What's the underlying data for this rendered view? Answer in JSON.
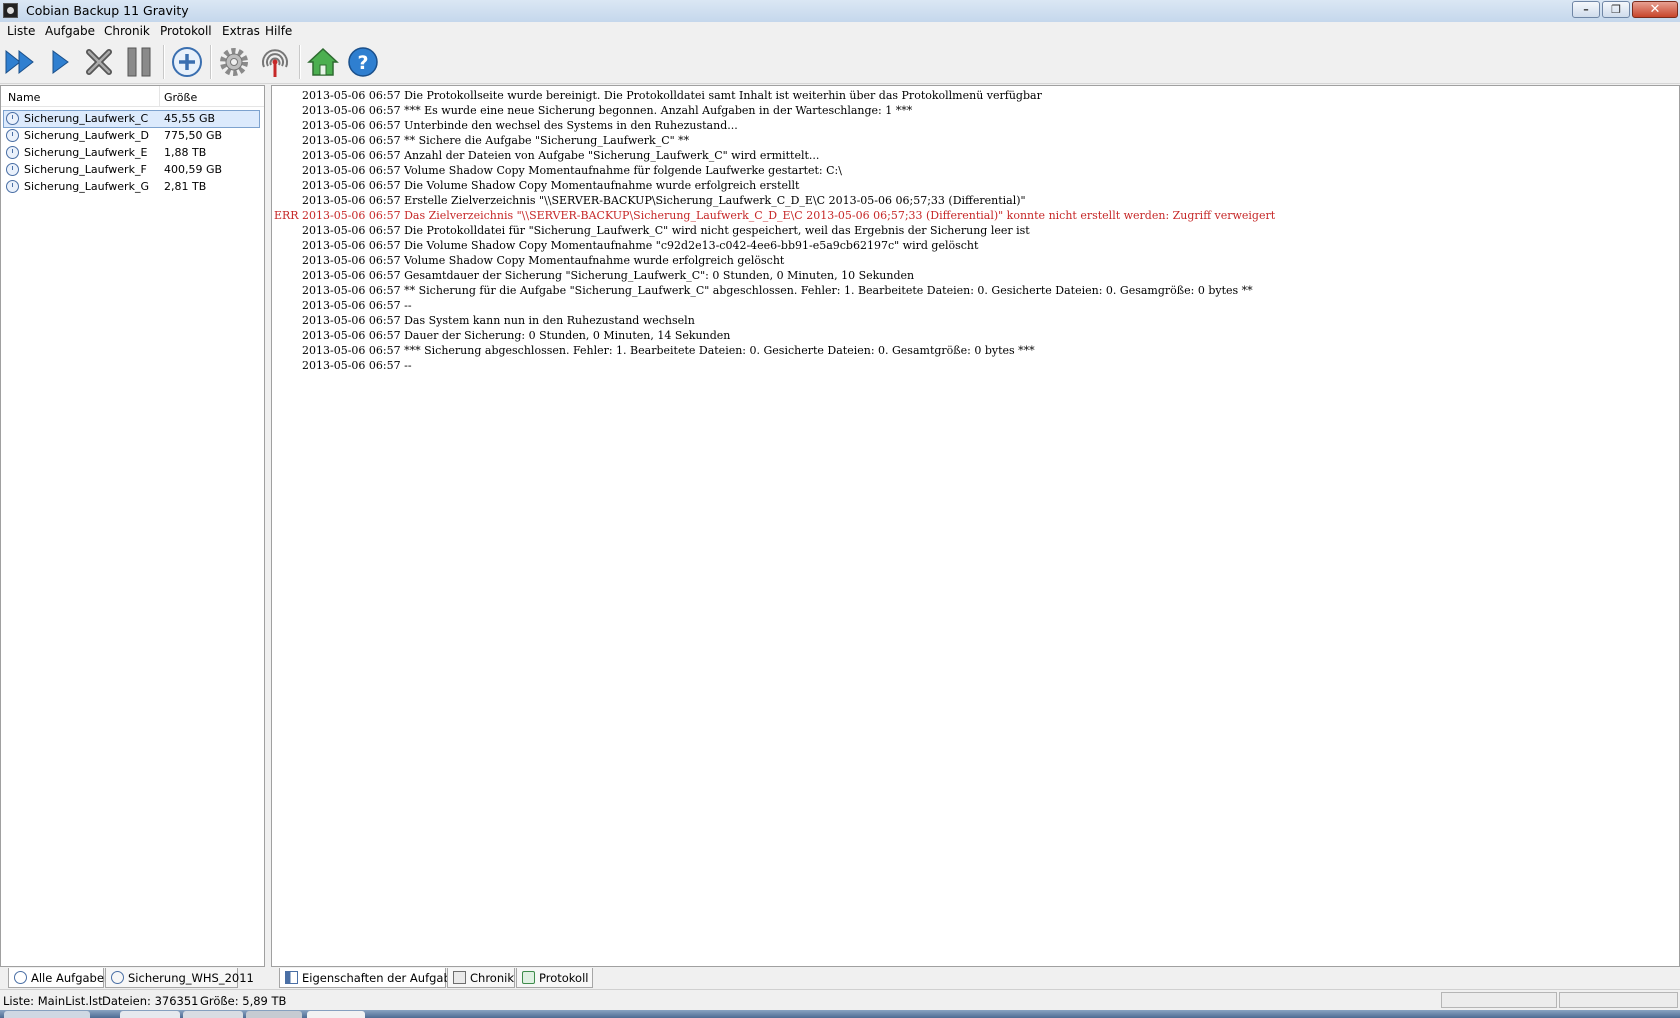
{
  "window": {
    "title": "Cobian Backup 11 Gravity"
  },
  "menu": [
    "Liste",
    "Aufgabe",
    "Chronik",
    "Protokoll",
    "Extras",
    "Hilfe"
  ],
  "toolbar": {
    "icons": [
      "run-all-icon",
      "run-selected-icon",
      "cancel-icon",
      "pause-icon",
      "add-task-icon",
      "settings-icon",
      "antenna-icon",
      "home-icon",
      "help-icon"
    ]
  },
  "task_list": {
    "columns": {
      "name": "Name",
      "size": "Größe"
    },
    "rows": [
      {
        "name": "Sicherung_Laufwerk_C",
        "size": "45,55 GB"
      },
      {
        "name": "Sicherung_Laufwerk_D",
        "size": "775,50 GB"
      },
      {
        "name": "Sicherung_Laufwerk_E",
        "size": "1,88 TB"
      },
      {
        "name": "Sicherung_Laufwerk_F",
        "size": "400,59 GB"
      },
      {
        "name": "Sicherung_Laufwerk_G",
        "size": "2,81 TB"
      }
    ]
  },
  "log": [
    {
      "prefix": "",
      "text": "2013-05-06 06:57 Die Protokollseite wurde bereinigt. Die Protokolldatei samt Inhalt ist weiterhin über das Protokollmenü verfügbar"
    },
    {
      "prefix": "",
      "text": "2013-05-06 06:57 *** Es wurde eine neue Sicherung begonnen. Anzahl Aufgaben in der Warteschlange: 1 ***"
    },
    {
      "prefix": "",
      "text": "2013-05-06 06:57 Unterbinde den wechsel des Systems in den Ruhezustand..."
    },
    {
      "prefix": "",
      "text": "2013-05-06 06:57 ** Sichere die Aufgabe \"Sicherung_Laufwerk_C\" **"
    },
    {
      "prefix": "",
      "text": "2013-05-06 06:57 Anzahl der Dateien von Aufgabe \"Sicherung_Laufwerk_C\" wird ermittelt..."
    },
    {
      "prefix": "",
      "text": "2013-05-06 06:57 Volume Shadow Copy Momentaufnahme für folgende Laufwerke gestartet: C:\\"
    },
    {
      "prefix": "",
      "text": "2013-05-06 06:57 Die Volume Shadow Copy Momentaufnahme wurde erfolgreich erstellt"
    },
    {
      "prefix": "",
      "text": "2013-05-06 06:57 Erstelle Zielverzeichnis \"\\\\SERVER-BACKUP\\Sicherung_Laufwerk_C_D_E\\C 2013-05-06 06;57;33 (Differential)\""
    },
    {
      "prefix": "ERR",
      "text": "2013-05-06 06:57 Das Zielverzeichnis \"\\\\SERVER-BACKUP\\Sicherung_Laufwerk_C_D_E\\C 2013-05-06 06;57;33 (Differential)\" konnte nicht erstellt werden: Zugriff verweigert",
      "error": true
    },
    {
      "prefix": "",
      "text": "2013-05-06 06:57 Die Protokolldatei für \"Sicherung_Laufwerk_C\" wird nicht gespeichert, weil das Ergebnis der Sicherung leer ist"
    },
    {
      "prefix": "",
      "text": "2013-05-06 06:57 Die Volume Shadow Copy Momentaufnahme \"c92d2e13-c042-4ee6-bb91-e5a9cb62197c\" wird gelöscht"
    },
    {
      "prefix": "",
      "text": "2013-05-06 06:57 Volume Shadow Copy Momentaufnahme wurde erfolgreich gelöscht"
    },
    {
      "prefix": "",
      "text": "2013-05-06 06:57 Gesamtdauer der Sicherung \"Sicherung_Laufwerk_C\": 0 Stunden, 0 Minuten, 10 Sekunden"
    },
    {
      "prefix": "",
      "text": "2013-05-06 06:57 ** Sicherung für die Aufgabe \"Sicherung_Laufwerk_C\" abgeschlossen. Fehler: 1. Bearbeitete Dateien: 0. Gesicherte Dateien: 0. Gesamgröße: 0 bytes **"
    },
    {
      "prefix": "",
      "text": "2013-05-06 06:57 --"
    },
    {
      "prefix": "",
      "text": "2013-05-06 06:57 Das System kann nun in den Ruhezustand wechseln"
    },
    {
      "prefix": "",
      "text": "2013-05-06 06:57 Dauer der Sicherung: 0 Stunden, 0 Minuten, 14 Sekunden"
    },
    {
      "prefix": "",
      "text": "2013-05-06 06:57 *** Sicherung abgeschlossen. Fehler: 1. Bearbeitete Dateien: 0. Gesicherte Dateien: 0. Gesamtgröße: 0 bytes ***"
    },
    {
      "prefix": "",
      "text": "2013-05-06 06:57 --"
    }
  ],
  "left_tabs": [
    "Alle Aufgaben",
    "Sicherung_WHS_2011"
  ],
  "right_tabs": [
    "Eigenschaften der Aufgabe",
    "Chronik",
    "Protokoll"
  ],
  "status": {
    "list": "Liste: MainList.lst",
    "files": "Dateien: 376351",
    "size": "Größe: 5,89 TB"
  },
  "colors": {
    "error": "#c62828",
    "selection": "#dceafc"
  }
}
